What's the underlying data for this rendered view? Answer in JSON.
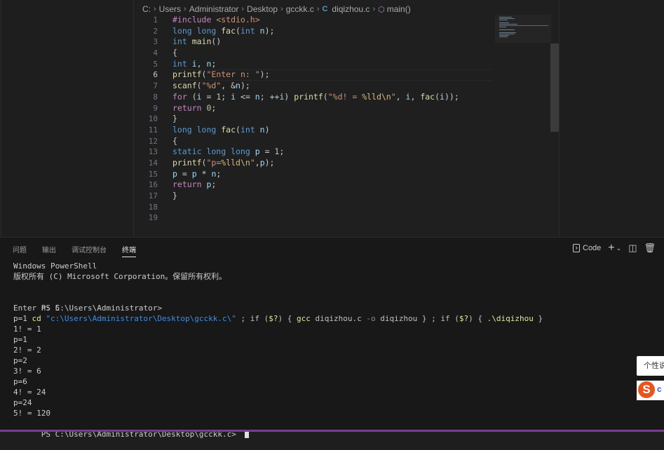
{
  "breadcrumb": {
    "parts": [
      "C:",
      "Users",
      "Administrator",
      "Desktop",
      "gcckk.c",
      "diqizhou.c",
      "main()"
    ]
  },
  "editor": {
    "line_numbers": [
      "1",
      "2",
      "3",
      "4",
      "5",
      "6",
      "7",
      "8",
      "9",
      "10",
      "11",
      "12",
      "13",
      "14",
      "15",
      "16",
      "17",
      "18",
      "19"
    ],
    "active_line": "6",
    "lines": [
      [
        [
          "pp",
          "#include "
        ],
        [
          "str",
          "<stdio.h>"
        ]
      ],
      [
        [
          "kw",
          "long long "
        ],
        [
          "fn",
          "fac"
        ],
        [
          "plain",
          "("
        ],
        [
          "kw",
          "int "
        ],
        [
          "id",
          "n"
        ],
        [
          "plain",
          ");"
        ]
      ],
      [
        [
          "kw",
          "int "
        ],
        [
          "fn",
          "main"
        ],
        [
          "plain",
          "()"
        ]
      ],
      [
        [
          "plain",
          "{"
        ]
      ],
      [
        [
          "kw",
          "int "
        ],
        [
          "id",
          "i"
        ],
        [
          "plain",
          ", "
        ],
        [
          "id",
          "n"
        ],
        [
          "plain",
          ";"
        ]
      ],
      [
        [
          "fn",
          "printf"
        ],
        [
          "plain",
          "("
        ],
        [
          "str",
          "\"Enter n: \""
        ],
        [
          "plain",
          ");"
        ]
      ],
      [
        [
          "fn",
          "scanf"
        ],
        [
          "plain",
          "("
        ],
        [
          "str",
          "\"%d\""
        ],
        [
          "plain",
          ", &"
        ],
        [
          "id",
          "n"
        ],
        [
          "plain",
          ");"
        ]
      ],
      [
        [
          "pp",
          "for "
        ],
        [
          "plain",
          "("
        ],
        [
          "id",
          "i"
        ],
        [
          "plain",
          " = "
        ],
        [
          "num",
          "1"
        ],
        [
          "plain",
          "; "
        ],
        [
          "id",
          "i"
        ],
        [
          "plain",
          " <= "
        ],
        [
          "id",
          "n"
        ],
        [
          "plain",
          "; ++"
        ],
        [
          "id",
          "i"
        ],
        [
          "plain",
          ") "
        ],
        [
          "fn",
          "printf"
        ],
        [
          "plain",
          "("
        ],
        [
          "str",
          "\"%d! = "
        ],
        [
          "esc",
          "%lld\\n"
        ],
        [
          "str",
          "\""
        ],
        [
          "plain",
          ", "
        ],
        [
          "id",
          "i"
        ],
        [
          "plain",
          ", "
        ],
        [
          "fn",
          "fac"
        ],
        [
          "plain",
          "("
        ],
        [
          "id",
          "i"
        ],
        [
          "plain",
          "));"
        ]
      ],
      [
        [
          "pp",
          "return "
        ],
        [
          "num",
          "0"
        ],
        [
          "plain",
          ";"
        ]
      ],
      [
        [
          "plain",
          "}"
        ]
      ],
      [
        [
          "kw",
          "long long "
        ],
        [
          "fn",
          "fac"
        ],
        [
          "plain",
          "("
        ],
        [
          "kw",
          "int "
        ],
        [
          "id",
          "n"
        ],
        [
          "plain",
          ")"
        ]
      ],
      [
        [
          "plain",
          "{"
        ]
      ],
      [
        [
          "kw",
          "static long long "
        ],
        [
          "id",
          "p"
        ],
        [
          "plain",
          " = "
        ],
        [
          "num",
          "1"
        ],
        [
          "plain",
          ";"
        ]
      ],
      [
        [
          "fn",
          "printf"
        ],
        [
          "plain",
          "("
        ],
        [
          "str",
          "\"p="
        ],
        [
          "esc",
          "%lld\\n"
        ],
        [
          "str",
          "\""
        ],
        [
          "plain",
          ","
        ],
        [
          "id",
          "p"
        ],
        [
          "plain",
          ");"
        ]
      ],
      [
        [
          "id",
          "p"
        ],
        [
          "plain",
          " = "
        ],
        [
          "id",
          "p"
        ],
        [
          "plain",
          " * "
        ],
        [
          "id",
          "n"
        ],
        [
          "plain",
          ";"
        ]
      ],
      [
        [
          "pp",
          "return "
        ],
        [
          "id",
          "p"
        ],
        [
          "plain",
          ";"
        ]
      ],
      [
        [
          "plain",
          "}"
        ]
      ],
      [],
      []
    ]
  },
  "panel": {
    "tabs": [
      "问题",
      "输出",
      "调试控制台",
      "终端"
    ],
    "active_tab": "终端",
    "terminal_profile": "Code",
    "icons": [
      "plus-icon",
      "chevron-down-icon",
      "split-icon",
      "trash-icon"
    ]
  },
  "terminal": {
    "lines": [
      "Windows PowerShell",
      "版权所有 (C) Microsoft Corporation。保留所有权利。",
      "",
      "Enter n: 5",
      "p=1",
      "1! = 1",
      "p=1",
      "2! = 2",
      "p=2",
      "3! = 6",
      "p=6",
      "4! = 24",
      "p=24",
      "5! = 120"
    ],
    "command_prompt": "PS C:\\Users\\Administrator> ",
    "command_tokens": [
      [
        "t-cmd",
        "cd "
      ],
      [
        "t-str",
        "\"c:\\Users\\Administrator\\Desktop\\gcckk.c\\\""
      ],
      [
        "t-op",
        " ; if ("
      ],
      [
        "t-cmd",
        "$?"
      ],
      [
        "t-op",
        ") { "
      ],
      [
        "t-cmd",
        "gcc "
      ],
      [
        "t-op",
        "diqizhou.c "
      ],
      [
        "t-flag",
        "-o "
      ],
      [
        "t-op",
        "diqizhou } ; if ("
      ],
      [
        "t-cmd",
        "$?"
      ],
      [
        "t-op",
        ") { "
      ],
      [
        "t-cmd",
        ".\\diqizhou"
      ],
      [
        "t-op",
        " }"
      ]
    ],
    "final_prompt": "PS C:\\Users\\Administrator\\Desktop\\gcckk.c> "
  },
  "tooltip": {
    "text": "个性说"
  },
  "ime": {
    "logo": "S",
    "label": "c"
  },
  "colors": {
    "editor_bg": "#1f1f1f",
    "panel_bg": "#181818",
    "accent": "#7b3d93",
    "ime_orange": "#e8551f"
  }
}
